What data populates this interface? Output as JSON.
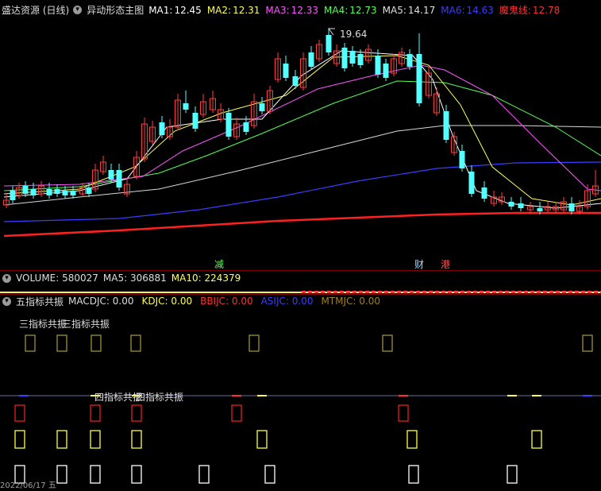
{
  "header": {
    "title": "盛达资源 (日线)",
    "indicator": "异动形态主图",
    "mas": [
      {
        "label": "MA1:",
        "value": "12.45",
        "color": "#ffffff"
      },
      {
        "label": "MA2:",
        "value": "12.31",
        "color": "#ffff54"
      },
      {
        "label": "MA3:",
        "value": "12.33",
        "color": "#ff54ff"
      },
      {
        "label": "MA4:",
        "value": "12.73",
        "color": "#54ff54"
      },
      {
        "label": "MA5:",
        "value": "14.17",
        "color": "#e0e0e0"
      },
      {
        "label": "MA6:",
        "value": "14.63",
        "color": "#3c3cff"
      },
      {
        "label": "魔鬼线:",
        "value": "12.78",
        "color": "#ff3030"
      }
    ]
  },
  "price_chart": {
    "high_label": "19.64",
    "markers": [
      {
        "text": "减",
        "color": "#54ff54"
      },
      {
        "text": "财",
        "color": "#9fd8ff"
      },
      {
        "text": "港",
        "color": "#ff5050"
      }
    ]
  },
  "volume": {
    "label": "VOLUME: 580027",
    "ma5": "MA5: 306881",
    "ma10": "MA10: 224379"
  },
  "signals": {
    "title": "五指标共振",
    "items": [
      {
        "label": "MACDJC: 0.00",
        "color": "#dddddd"
      },
      {
        "label": "KDJC: 0.00",
        "color": "#ffff54"
      },
      {
        "label": "BBIJC: 0.00",
        "color": "#ff3030"
      },
      {
        "label": "ASIJC: 0.00",
        "color": "#3c3cff"
      },
      {
        "label": "MTMJC: 0.00",
        "color": "#a08020"
      }
    ],
    "three_label": "三指标共振",
    "three_label_overlap": "三指标共振",
    "four_label": "四指标共振",
    "four_label_overlap": "四指标共振"
  },
  "colors": {
    "up": "#ff3c3c",
    "down": "#54ffff",
    "bg": "#000000"
  },
  "footer": {
    "date": "2022/06/17 五"
  }
}
